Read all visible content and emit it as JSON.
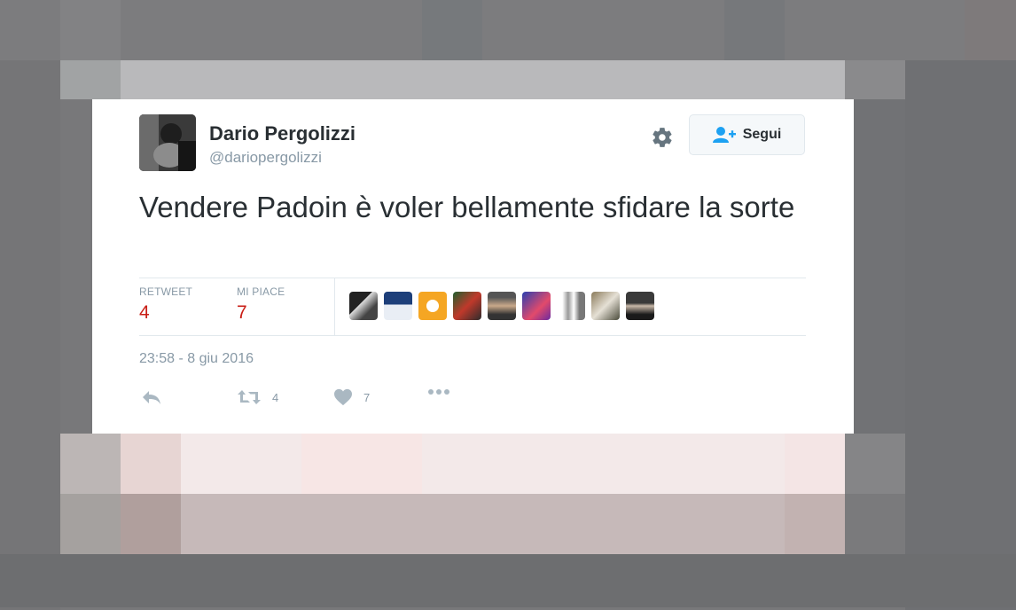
{
  "tweet": {
    "author_name": "Dario Pergolizzi",
    "author_handle": "@dariopergolizzi",
    "follow_label": "Segui",
    "text": "Vendere Padoin è voler bellamente sfidare la sorte",
    "retweet_label": "RETWEET",
    "retweet_count": "4",
    "like_label": "MI PIACE",
    "like_count": "7",
    "timestamp": "23:58 - 8 giu 2016",
    "actions": {
      "reply_icon": "reply-icon",
      "retweet_icon": "retweet-icon",
      "retweet_count": "4",
      "like_icon": "heart-icon",
      "like_count": "7",
      "more_icon": "more-icon"
    }
  },
  "colors": {
    "accent_blue": "#1da1f2",
    "count_red": "#c91e16",
    "muted": "#8899a6",
    "text": "#292f33"
  },
  "likers_icons": [
    "liker-avatar",
    "liker-avatar",
    "liker-avatar",
    "liker-avatar",
    "liker-avatar",
    "liker-avatar",
    "liker-avatar",
    "liker-avatar",
    "liker-avatar"
  ]
}
